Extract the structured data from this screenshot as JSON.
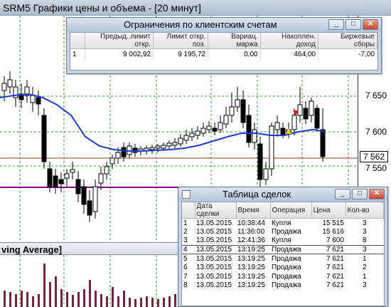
{
  "window": {
    "title": "SRM5 Графики цены и объема - [20 минут]"
  },
  "chart": {
    "price_labels": [
      "7 650",
      "7 600",
      "7 550"
    ],
    "current_price": "7 562",
    "indicator_label": "ving Average]",
    "colors": {
      "ma_line": "#1a3bd8",
      "limit_line": "#8b008b",
      "grid": "#2f8f2f",
      "volume_bars": "#8b1a3a"
    }
  },
  "limits_window": {
    "title": "Ограничения по клиентским счетам",
    "buttons": {
      "minimize": "_",
      "restore": "□",
      "close": "✕"
    },
    "columns": [
      "",
      "Предыд. лимит откр.",
      "Лимит откр. поз.",
      "Вариац. маржа",
      "Накоплен. доход",
      "Биржевые сборы"
    ],
    "rows": [
      [
        "1",
        "9 002,92",
        "9 195,72",
        "0,00",
        "464,00",
        "-7,00"
      ]
    ]
  },
  "deals_window": {
    "title": "Таблица сделок",
    "buttons": {
      "minimize": "_",
      "restore": "□",
      "close": "✕"
    },
    "columns": [
      "",
      "Дата сделки",
      "Время",
      "Операция",
      "Цена",
      "Кол-во"
    ],
    "rows": [
      [
        "1",
        "13.05.2015",
        "10:38:44",
        "Купля",
        "15 515",
        "3"
      ],
      [
        "2",
        "13.05.2015",
        "11:36:00",
        "Продажа",
        "15 616",
        "3"
      ],
      [
        "3",
        "13.05.2015",
        "12:41:36",
        "Купля",
        "7 600",
        "8"
      ],
      [
        "4",
        "13.05.2015",
        "13:19:25",
        "Продажа",
        "7 621",
        "3"
      ],
      [
        "5",
        "13.05.2015",
        "13:19:25",
        "Продажа",
        "7 621",
        "1"
      ],
      [
        "6",
        "13.05.2015",
        "13:19:25",
        "Продажа",
        "7 621",
        "2"
      ],
      [
        "7",
        "13.05.2015",
        "13:19:25",
        "Продажа",
        "7 621",
        "1"
      ],
      [
        "8",
        "13.05.2015",
        "13:19:25",
        "Продажа",
        "7 621",
        "3"
      ]
    ],
    "selected_row": 4
  }
}
